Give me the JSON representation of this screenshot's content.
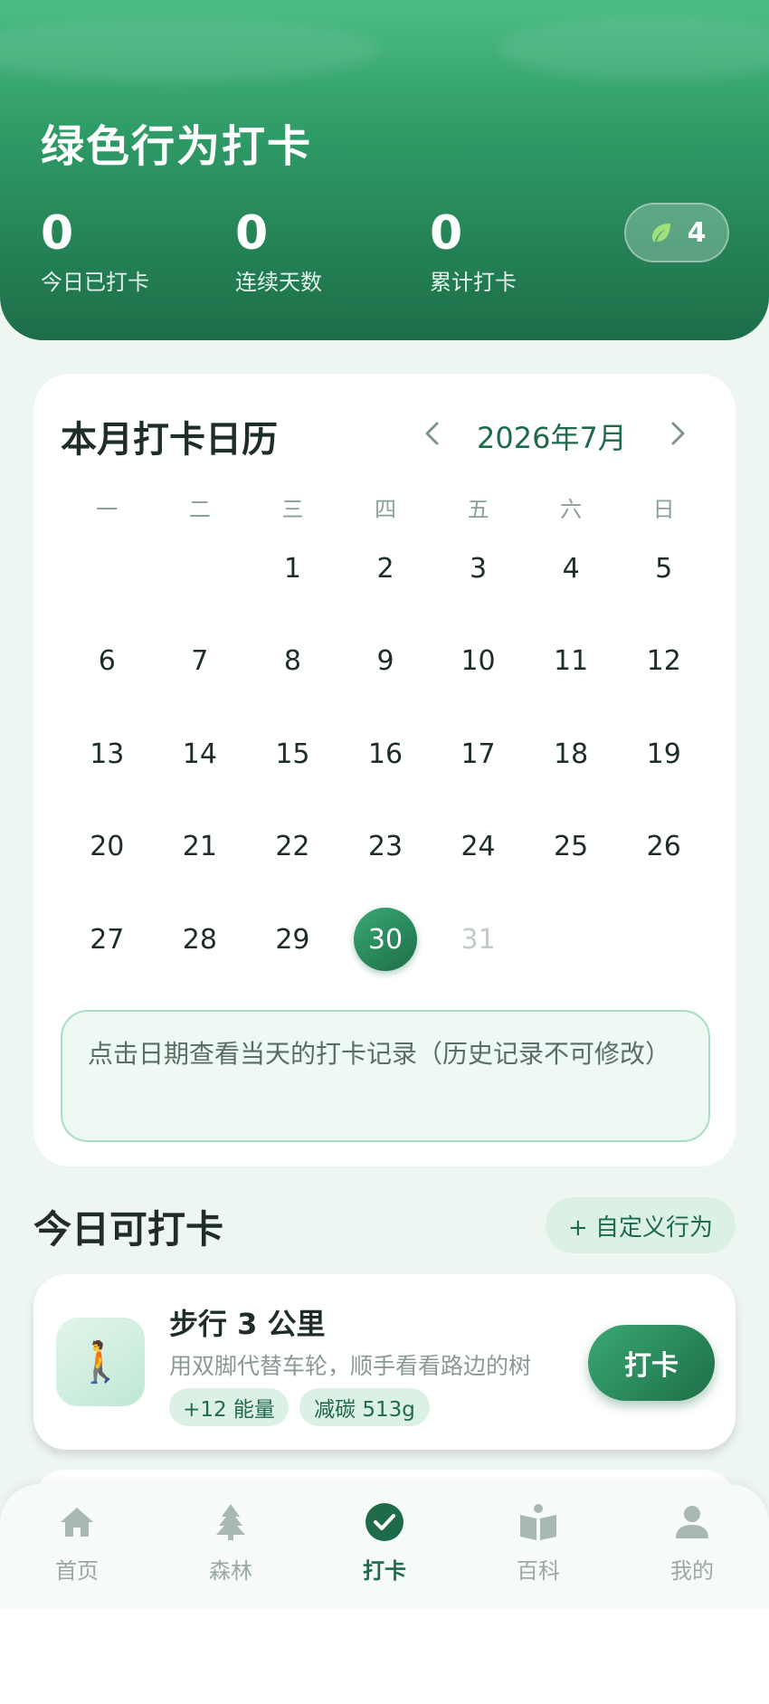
{
  "header": {
    "title": "绿色行为打卡",
    "stats": [
      {
        "value": "0",
        "label": "今日已打卡"
      },
      {
        "value": "0",
        "label": "连续天数"
      },
      {
        "value": "0",
        "label": "累计打卡"
      }
    ],
    "energy": "4",
    "energy_icon": "leaf-icon"
  },
  "calendar": {
    "title": "本月打卡日历",
    "month": "2026年7月",
    "weekdays": [
      "一",
      "二",
      "三",
      "四",
      "五",
      "六",
      "日"
    ],
    "first_weekday_index": 2,
    "days_in_month": 31,
    "today": 30,
    "tip": "点击日期查看当天的打卡记录（历史记录不可修改）"
  },
  "section": {
    "title": "今日可打卡",
    "custom_button": "+ 自定义行为"
  },
  "action": {
    "name": "步行 3 公里",
    "description": "用双脚代替车轮，顺手看看路边的树",
    "icon": "🚶",
    "tags": [
      "+12 能量",
      "减碳 513g"
    ],
    "button": "打卡"
  },
  "tabs": [
    {
      "label": "首页",
      "icon": "home-icon",
      "active": false
    },
    {
      "label": "森林",
      "icon": "tree-icon",
      "active": false
    },
    {
      "label": "打卡",
      "icon": "check-circle-icon",
      "active": true
    },
    {
      "label": "百科",
      "icon": "book-icon",
      "active": false
    },
    {
      "label": "我的",
      "icon": "user-icon",
      "active": false
    }
  ],
  "colors": {
    "primary": "#1f6b49",
    "header_top": "#4cbd86",
    "header_bottom": "#1d6e48",
    "background": "#eef6f2",
    "tag_bg": "#dbf1e5"
  }
}
